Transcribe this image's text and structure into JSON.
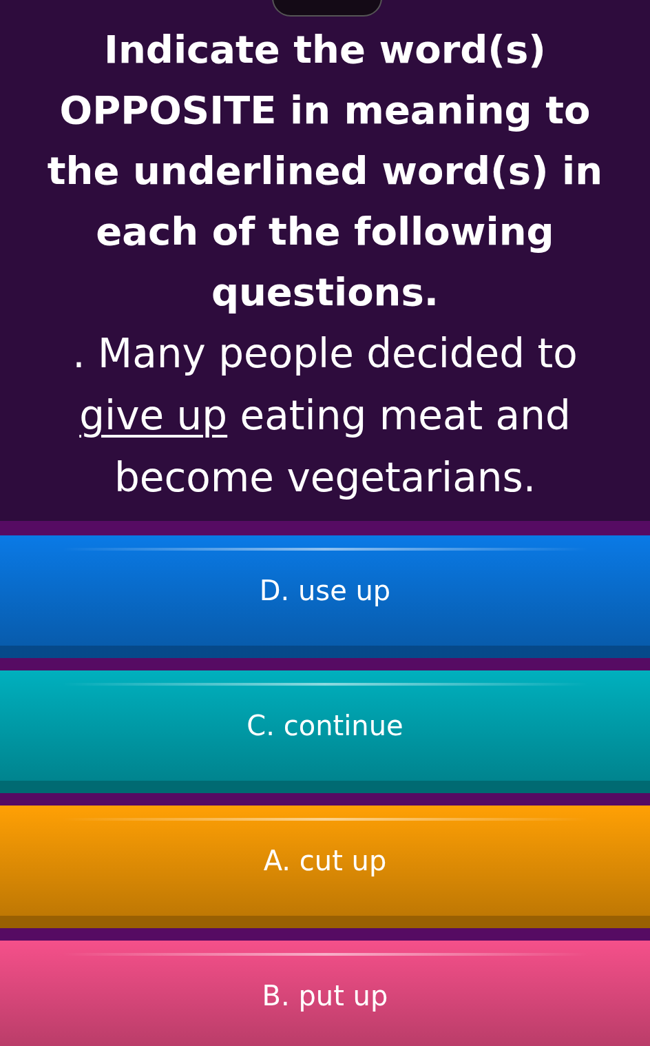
{
  "instruction": "Indicate the word(s) OPPOSITE in meaning to the underlined word(s) in each of the following questions.",
  "question": [
    {
      "text": ". Many people decided to ",
      "underlined": false
    },
    {
      "text": "give up",
      "underlined": true
    },
    {
      "text": " eating meat and become vegetarians.",
      "underlined": false
    }
  ],
  "options": [
    {
      "label": "D. use up",
      "color": "#0a7ae6"
    },
    {
      "label": "C. continue",
      "color": "#00b0be"
    },
    {
      "label": "A. cut up",
      "color": "#ffa005"
    },
    {
      "label": "B. put up",
      "color": "#f5508a"
    }
  ]
}
